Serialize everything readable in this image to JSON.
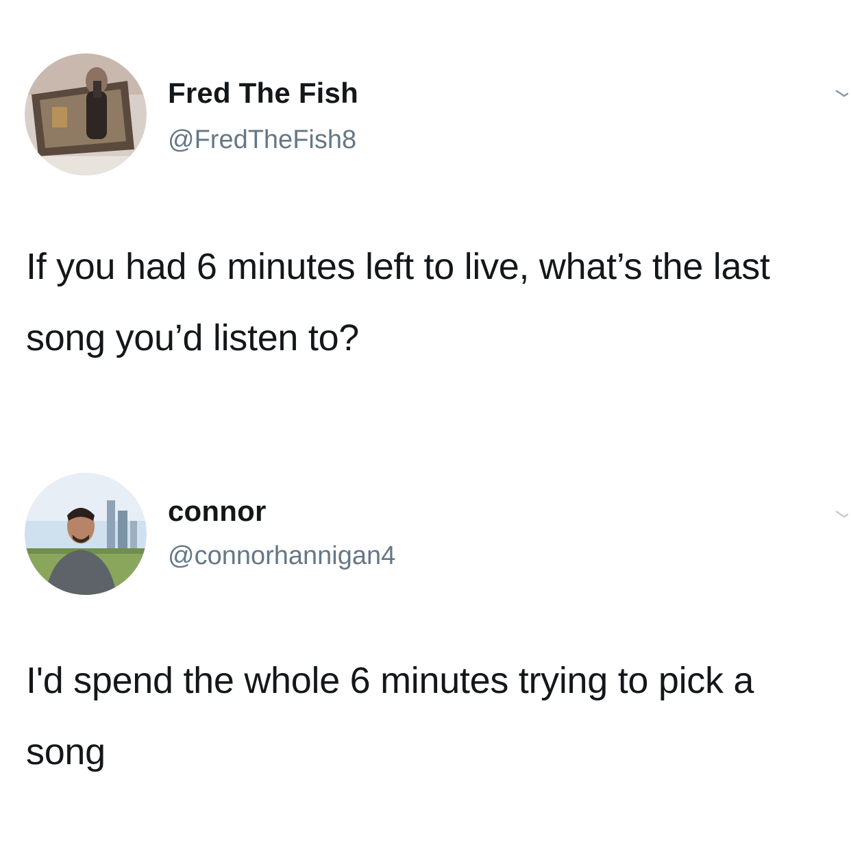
{
  "tweets": [
    {
      "display_name": "Fred The Fish",
      "handle": "@FredTheFish8",
      "text": "If you had 6 minutes left to live, what’s the last song you’d listen to?",
      "avatar_icon": "profile-photo-mirror-selfie"
    },
    {
      "display_name": "connor",
      "handle": "@connorhannigan4",
      "text": "I'd spend the whole 6 minutes trying to pick a song",
      "avatar_icon": "profile-photo-outdoor-portrait"
    }
  ],
  "colors": {
    "name": "#14171a",
    "handle": "#657786",
    "background": "#ffffff"
  }
}
